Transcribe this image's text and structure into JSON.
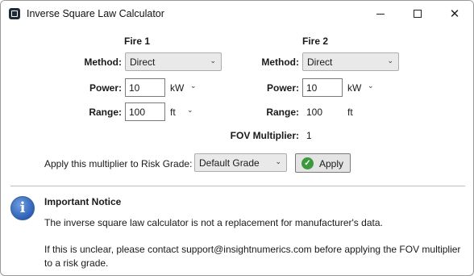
{
  "window": {
    "title": "Inverse Square Law Calculator"
  },
  "fire1": {
    "heading": "Fire 1",
    "method_label": "Method:",
    "method_value": "Direct",
    "power_label": "Power:",
    "power_value": "10",
    "power_unit": "kW",
    "range_label": "Range:",
    "range_value": "100",
    "range_unit": "ft"
  },
  "fire2": {
    "heading": "Fire 2",
    "method_label": "Method:",
    "method_value": "Direct",
    "power_label": "Power:",
    "power_value": "10",
    "power_unit": "kW",
    "range_label": "Range:",
    "range_value": "100",
    "range_unit": "ft"
  },
  "fov": {
    "label": "FOV Multiplier:",
    "value": "1"
  },
  "apply": {
    "prompt": "Apply this multiplier to Risk Grade:",
    "grade_value": "Default Grade",
    "button_label": "Apply"
  },
  "notice": {
    "title": "Important Notice",
    "line1": "The inverse square law calculator is not a replacement for manufacturer's data.",
    "line2": "If this is unclear, please contact support@insightnumerics.com before applying the FOV multiplier",
    "line3": "to a risk grade."
  },
  "icons": {
    "app": "app-icon",
    "minimize": "minimize-icon",
    "maximize": "maximize-icon",
    "close": "close-icon",
    "dropdown": "chevron-down-icon",
    "apply": "check-circle-icon",
    "info": "info-icon"
  },
  "colors": {
    "apply_check": "#3c9a3c",
    "info_blue": "#2d5fb5"
  }
}
